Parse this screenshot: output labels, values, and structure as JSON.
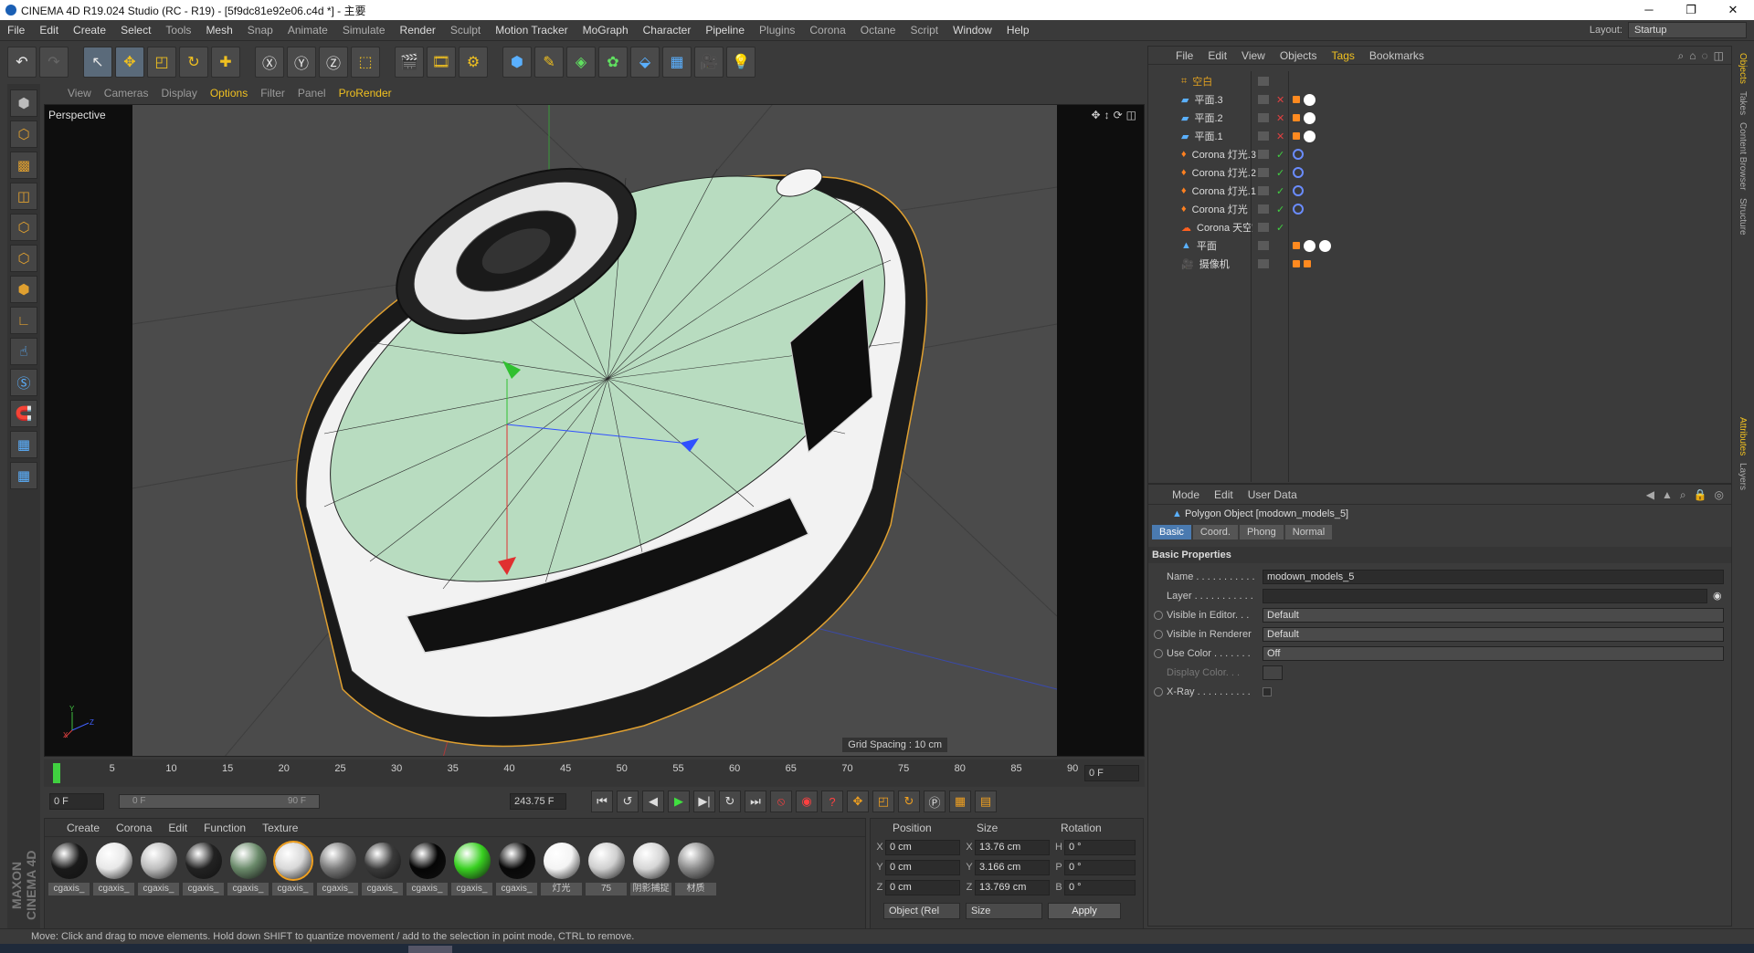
{
  "window": {
    "title": "CINEMA 4D R19.024 Studio (RC - R19) - [5f9dc81e92e06.c4d *] - 主要"
  },
  "menubar": {
    "items": [
      "File",
      "Edit",
      "Create",
      "Select",
      "Tools",
      "Mesh",
      "Snap",
      "Animate",
      "Simulate",
      "Render",
      "Sculpt",
      "Motion Tracker",
      "MoGraph",
      "Character",
      "Pipeline",
      "Plugins",
      "Corona",
      "Octane",
      "Script",
      "Window",
      "Help"
    ],
    "layout_label": "Layout:",
    "layout_value": "Startup"
  },
  "viewport": {
    "menu": [
      "View",
      "Cameras",
      "Display",
      "Options",
      "Filter",
      "Panel",
      "ProRender"
    ],
    "label": "Perspective",
    "grid_spacing": "Grid Spacing : 10 cm"
  },
  "timeline": {
    "ticks": [
      "0",
      "5",
      "10",
      "15",
      "20",
      "25",
      "30",
      "35",
      "40",
      "45",
      "50",
      "55",
      "60",
      "65",
      "70",
      "75",
      "80",
      "85",
      "90"
    ],
    "frame_end": "0 F",
    "start_field": "0 F",
    "range_start": "0 F",
    "range_end": "90 F",
    "current_field": "243.75 F"
  },
  "material_panel": {
    "menu": [
      "Create",
      "Corona",
      "Edit",
      "Function",
      "Texture"
    ],
    "materials": [
      {
        "label": "cgaxis_",
        "color": "#1a1a1a"
      },
      {
        "label": "cgaxis_",
        "color": "#e8e8e8"
      },
      {
        "label": "cgaxis_",
        "color": "#bdbdbd"
      },
      {
        "label": "cgaxis_",
        "color": "#222222"
      },
      {
        "label": "cgaxis_",
        "color": "#6a8a6a"
      },
      {
        "label": "cgaxis_",
        "color": "#d8d8d8"
      },
      {
        "label": "cgaxis_",
        "color": "#7a7a7a"
      },
      {
        "label": "cgaxis_",
        "color": "#3a3a3a"
      },
      {
        "label": "cgaxis_",
        "color": "#050505"
      },
      {
        "label": "cgaxis_",
        "color": "#38d020"
      },
      {
        "label": "cgaxis_",
        "color": "#080808"
      },
      {
        "label": "灯光",
        "color": "#f4f4f4"
      },
      {
        "label": "75",
        "color": "#cfcfcf"
      },
      {
        "label": "阴影捕捉",
        "color": "#d6d6d6"
      },
      {
        "label": "材质",
        "color": "#8a8a8a"
      }
    ]
  },
  "coords": {
    "headers": [
      "Position",
      "Size",
      "Rotation"
    ],
    "rows": [
      {
        "axis": "X",
        "pos": "0 cm",
        "size_axis": "X",
        "size": "13.76 cm",
        "rot_axis": "H",
        "rot": "0 °"
      },
      {
        "axis": "Y",
        "pos": "0 cm",
        "size_axis": "Y",
        "size": "3.166 cm",
        "rot_axis": "P",
        "rot": "0 °"
      },
      {
        "axis": "Z",
        "pos": "0 cm",
        "size_axis": "Z",
        "size": "13.769 cm",
        "rot_axis": "B",
        "rot": "0 °"
      }
    ],
    "mode": "Object (Rel",
    "size_mode": "Size",
    "apply": "Apply"
  },
  "status": "Move: Click and drag to move elements. Hold down SHIFT to quantize movement / add to the selection in point mode, CTRL to remove.",
  "objects": {
    "menu": [
      "File",
      "Edit",
      "View",
      "Objects",
      "Tags",
      "Bookmarks"
    ],
    "rows": [
      {
        "name": "空白",
        "type": "null",
        "yellow": true,
        "status": "none",
        "tags": []
      },
      {
        "name": "平面.3",
        "type": "plane",
        "status": "x",
        "tags": [
          "orange",
          "white"
        ]
      },
      {
        "name": "平面.2",
        "type": "plane",
        "status": "x",
        "tags": [
          "orange",
          "white"
        ]
      },
      {
        "name": "平面.1",
        "type": "plane",
        "status": "x",
        "tags": [
          "orange",
          "white"
        ]
      },
      {
        "name": "Corona 灯光.3",
        "type": "light",
        "status": "check",
        "tags": [
          "ring"
        ]
      },
      {
        "name": "Corona 灯光.2",
        "type": "light",
        "status": "check",
        "tags": [
          "ring"
        ]
      },
      {
        "name": "Corona 灯光.1",
        "type": "light",
        "status": "check",
        "tags": [
          "ring"
        ]
      },
      {
        "name": "Corona 灯光",
        "type": "light",
        "status": "check",
        "tags": [
          "ring"
        ]
      },
      {
        "name": "Corona 天空",
        "type": "sky",
        "status": "check",
        "tags": []
      },
      {
        "name": "平面",
        "type": "poly",
        "status": "none",
        "tags": [
          "orange",
          "white",
          "white"
        ]
      },
      {
        "name": "摄像机",
        "type": "camera",
        "status": "none",
        "tags": [
          "orange",
          "orange"
        ]
      }
    ]
  },
  "attributes": {
    "menu": [
      "Mode",
      "Edit",
      "User Data"
    ],
    "object_title": "Polygon Object [modown_models_5]",
    "tabs": [
      "Basic",
      "Coord.",
      "Phong",
      "Normal"
    ],
    "section": "Basic Properties",
    "fields": {
      "name_label": "Name . . . . . . . . . . .",
      "name_value": "modown_models_5",
      "layer_label": "Layer . . . . . . . . . . .",
      "layer_value": "",
      "vis_editor_label": "Visible in Editor. . .",
      "vis_editor_value": "Default",
      "vis_render_label": "Visible in Renderer",
      "vis_render_value": "Default",
      "use_color_label": "Use Color . . . . . . .",
      "use_color_value": "Off",
      "display_color_label": "Display Color. . .",
      "xray_label": "X-Ray . . . . . . . . . ."
    }
  },
  "right_tabs": [
    "Objects",
    "Takes",
    "Content Browser",
    "Structure",
    "Attributes",
    "Layers"
  ]
}
